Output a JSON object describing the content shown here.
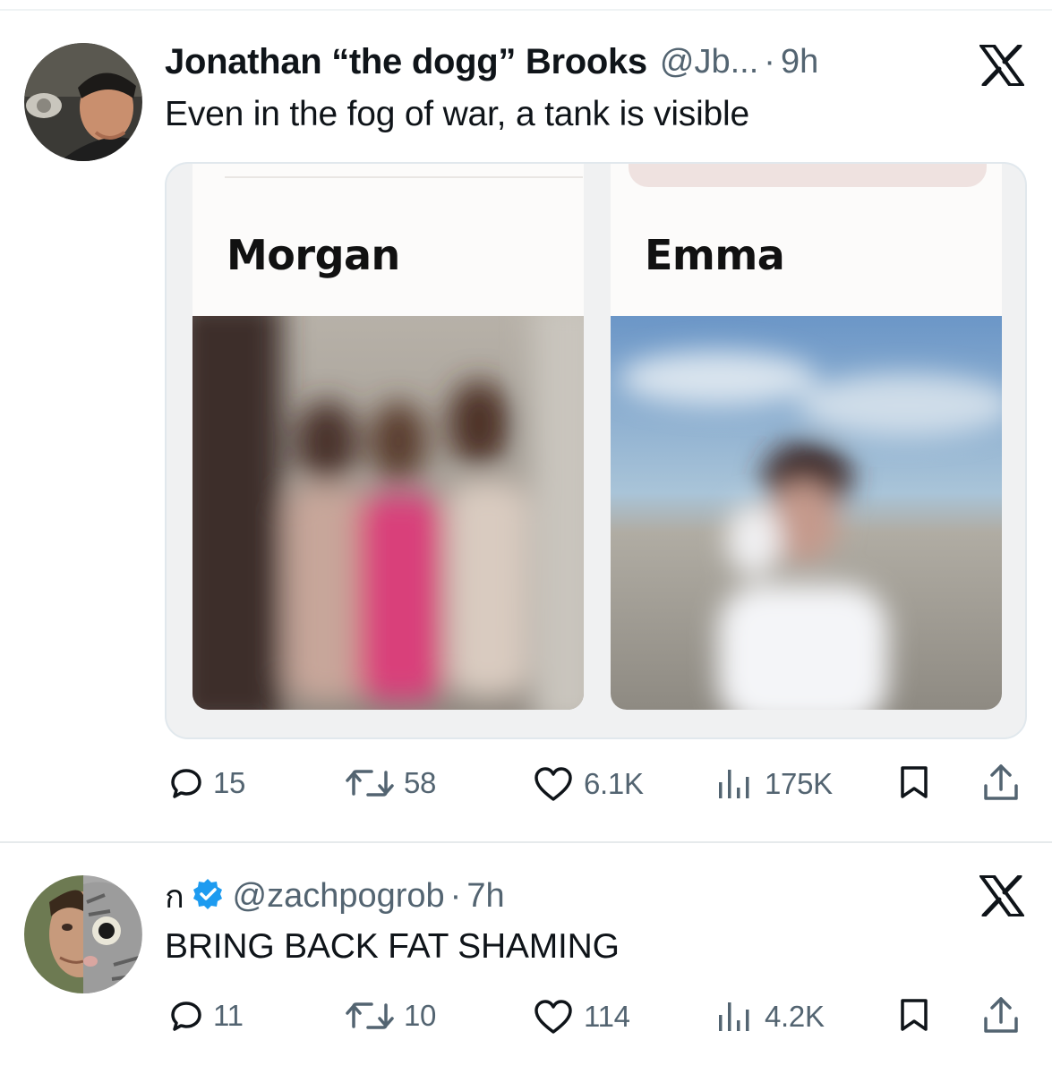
{
  "tweets": [
    {
      "display_name": "Jonathan “the dogg” Brooks",
      "handle": "@Jb...",
      "separator": "·",
      "time": "9h",
      "text": "Even in the fog of war, a tank is visible",
      "media": {
        "left_name": "Morgan",
        "right_name": "Emma"
      },
      "stats": {
        "replies": "15",
        "reposts": "58",
        "likes": "6.1K",
        "views": "175K"
      }
    },
    {
      "display_name": "ก",
      "handle": "@zachpogrob",
      "separator": "·",
      "time": "7h",
      "text": "BRING BACK FAT SHAMING",
      "verified": true,
      "stats": {
        "replies": "11",
        "reposts": "10",
        "likes": "114",
        "views": "4.2K"
      }
    }
  ],
  "icons": {
    "reply": "reply-icon",
    "repost": "repost-icon",
    "like": "heart-icon",
    "views": "analytics-icon",
    "bookmark": "bookmark-icon",
    "share": "share-icon",
    "close": "x-logo-icon",
    "verified": "verified-badge-icon"
  },
  "colors": {
    "text": "#0f1419",
    "secondary": "#536471",
    "verified": "#1d9bf0",
    "divider": "#eff3f4"
  }
}
